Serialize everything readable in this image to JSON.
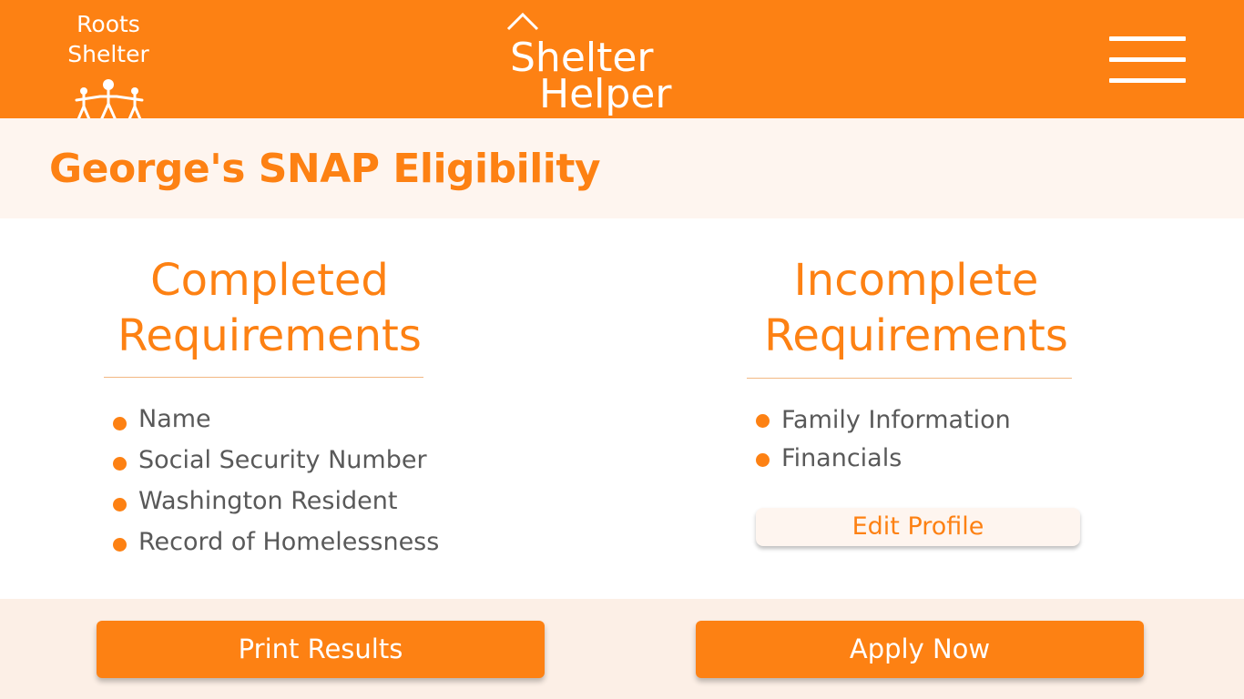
{
  "header": {
    "org_logo": {
      "line1": "Roots",
      "line2": "Shelter",
      "icon": "family-icon"
    },
    "brand": {
      "line1": "Shelter",
      "line2": "Helper",
      "icon": "house-roof-icon"
    },
    "menu_icon": "hamburger-menu-icon"
  },
  "page": {
    "title": "George's SNAP Eligibility"
  },
  "completed": {
    "heading_line1": "Completed",
    "heading_line2": "Requirements",
    "items": [
      "Name",
      "Social Security Number",
      "Washington Resident",
      "Record of Homelessness"
    ]
  },
  "incomplete": {
    "heading_line1": "Incomplete",
    "heading_line2": "Requirements",
    "items": [
      "Family Information",
      "Financials"
    ],
    "edit_button": "Edit Profile"
  },
  "footer": {
    "print_button": "Print Results",
    "apply_button": "Apply Now"
  },
  "colors": {
    "accent": "#fd8113",
    "band_light": "#fef5ef",
    "footer_bg": "#fcefe6",
    "body_text": "#595959"
  }
}
